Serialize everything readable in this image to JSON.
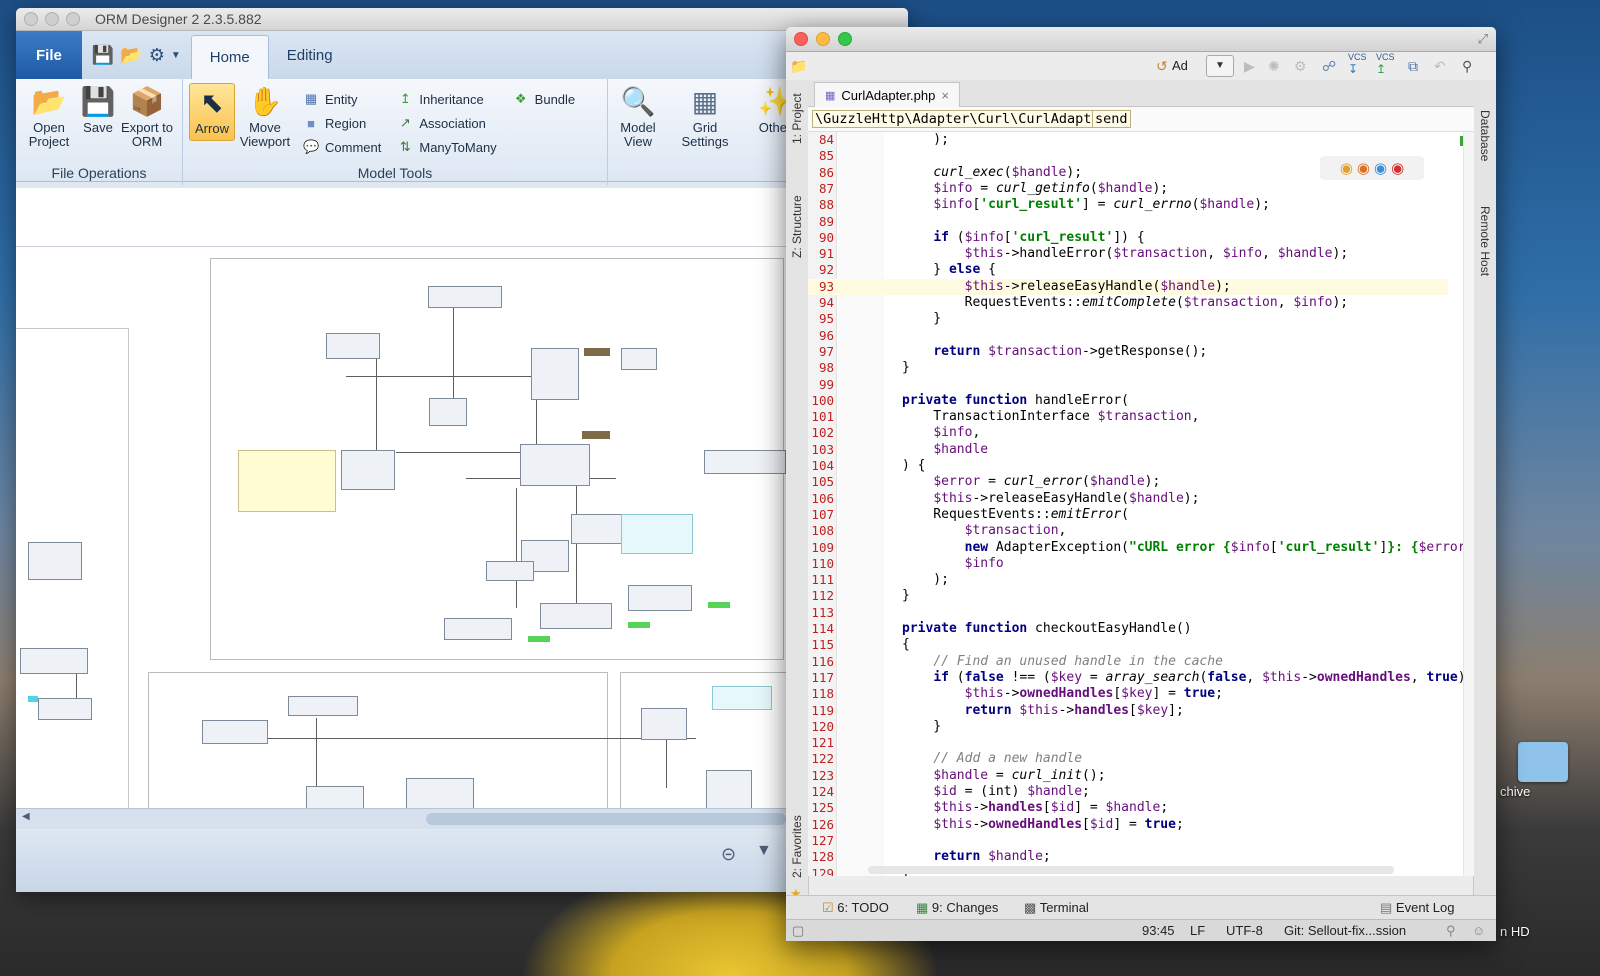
{
  "orm": {
    "title": "ORM Designer 2 2.3.5.882",
    "tabs": {
      "file": "File",
      "home": "Home",
      "editing": "Editing"
    },
    "groups": {
      "file_ops": "File Operations",
      "model_tools": "Model Tools"
    },
    "buttons": {
      "open_project": "Open Project",
      "save": "Save",
      "export_orm": "Export to ORM",
      "arrow": "Arrow",
      "move_viewport": "Move Viewport",
      "entity": "Entity",
      "region": "Region",
      "comment": "Comment",
      "inheritance": "Inheritance",
      "association": "Association",
      "many_to_many": "ManyToMany",
      "bundle": "Bundle",
      "model_view": "Model View",
      "grid_settings": "Grid Settings",
      "other": "Other"
    }
  },
  "ide": {
    "file_tab": "CurlAdapter.php",
    "toolbar_run_config": "Ad",
    "vcs1": "VCS",
    "vcs2": "VCS",
    "breadcrumb_path": "\\GuzzleHttp\\Adapter\\Curl\\CurlAdapter",
    "breadcrumb_method": "send",
    "left_tabs": {
      "project": "1: Project",
      "structure": "Z: Structure",
      "favorites": "2: Favorites"
    },
    "right_tabs": {
      "database": "Database",
      "remote_host": "Remote Host"
    },
    "bottom_tabs": {
      "todo": "6: TODO",
      "changes": "9: Changes",
      "terminal": "Terminal",
      "event_log": "Event Log"
    },
    "status": {
      "position": "93:45",
      "line_sep": "LF",
      "encoding": "UTF-8",
      "git": "Git: Sellout-fix...ssion"
    },
    "code_lines": [
      {
        "n": "84",
        "html": "    );"
      },
      {
        "n": "85",
        "html": ""
      },
      {
        "n": "86",
        "html": "    <span class='fn'>curl_exec</span>(<span class='var'>$handle</span>);"
      },
      {
        "n": "87",
        "html": "    <span class='var'>$info</span> = <span class='fn'>curl_getinfo</span>(<span class='var'>$handle</span>);"
      },
      {
        "n": "88",
        "html": "    <span class='var'>$info</span>[<span class='str'>'curl_result'</span>] = <span class='fn'>curl_errno</span>(<span class='var'>$handle</span>);"
      },
      {
        "n": "89",
        "html": ""
      },
      {
        "n": "90",
        "html": "    <span class='kw'>if</span> (<span class='var'>$info</span>[<span class='str'>'curl_result'</span>]) {"
      },
      {
        "n": "91",
        "html": "        <span class='var'>$this</span>->handleError(<span class='var'>$transaction</span>, <span class='var'>$info</span>, <span class='var'>$handle</span>);"
      },
      {
        "n": "92",
        "html": "    } <span class='kw'>else</span> {"
      },
      {
        "n": "93",
        "html": "        <span class='var'>$this</span>->releaseEasyHandle(<span class='var'>$handle</span>);",
        "cur": true
      },
      {
        "n": "94",
        "html": "        RequestEvents::<span class='fn'>emitComplete</span>(<span class='var'>$transaction</span>, <span class='var'>$info</span>);"
      },
      {
        "n": "95",
        "html": "    }"
      },
      {
        "n": "96",
        "html": ""
      },
      {
        "n": "97",
        "html": "    <span class='kw'>return</span> <span class='var'>$transaction</span>->getResponse();"
      },
      {
        "n": "98",
        "html": "}"
      },
      {
        "n": "99",
        "html": ""
      },
      {
        "n": "100",
        "html": "<span class='kw'>private function</span> handleError("
      },
      {
        "n": "101",
        "html": "    TransactionInterface <span class='var'>$transaction</span>,"
      },
      {
        "n": "102",
        "html": "    <span class='var'>$info</span>,"
      },
      {
        "n": "103",
        "html": "    <span class='var'>$handle</span>"
      },
      {
        "n": "104",
        "html": ") {"
      },
      {
        "n": "105",
        "html": "    <span class='var'>$error</span> = <span class='fn'>curl_error</span>(<span class='var'>$handle</span>);"
      },
      {
        "n": "106",
        "html": "    <span class='var'>$this</span>->releaseEasyHandle(<span class='var'>$handle</span>);"
      },
      {
        "n": "107",
        "html": "    RequestEvents::<span class='fn'>emitError</span>("
      },
      {
        "n": "108",
        "html": "        <span class='var'>$transaction</span>,"
      },
      {
        "n": "109",
        "html": "        <span class='kw'>new</span> AdapterException(<span class='str'>\"cURL error {</span><span class='var'>$info</span>[<span class='str'>'curl_result'</span>]<span class='str'>}: {</span><span class='var'>$error</span>"
      },
      {
        "n": "110",
        "html": "        <span class='var'>$info</span>"
      },
      {
        "n": "111",
        "html": "    );"
      },
      {
        "n": "112",
        "html": "}"
      },
      {
        "n": "113",
        "html": ""
      },
      {
        "n": "114",
        "html": "<span class='kw'>private function</span> checkoutEasyHandle()"
      },
      {
        "n": "115",
        "html": "{"
      },
      {
        "n": "116",
        "html": "    <span class='cmt'>// Find an unused handle in the cache</span>"
      },
      {
        "n": "117",
        "html": "    <span class='kw'>if</span> (<span class='kw'>false</span> !== (<span class='var'>$key</span> = <span class='fn'>array_search</span>(<span class='kw'>false</span>, <span class='var'>$this</span>-><span class='var'><b>ownedHandles</b></span>, <span class='kw'>true</span>)"
      },
      {
        "n": "118",
        "html": "        <span class='var'>$this</span>-><span class='var'><b>ownedHandles</b></span>[<span class='var'>$key</span>] = <span class='kw'>true</span>;"
      },
      {
        "n": "119",
        "html": "        <span class='kw'>return</span> <span class='var'>$this</span>-><span class='var'><b>handles</b></span>[<span class='var'>$key</span>];"
      },
      {
        "n": "120",
        "html": "    }"
      },
      {
        "n": "121",
        "html": ""
      },
      {
        "n": "122",
        "html": "    <span class='cmt'>// Add a new handle</span>"
      },
      {
        "n": "123",
        "html": "    <span class='var'>$handle</span> = <span class='fn'>curl_init</span>();"
      },
      {
        "n": "124",
        "html": "    <span class='var'>$id</span> = (int) <span class='var'>$handle</span>;"
      },
      {
        "n": "125",
        "html": "    <span class='var'>$this</span>-><span class='var'><b>handles</b></span>[<span class='var'>$id</span>] = <span class='var'>$handle</span>;"
      },
      {
        "n": "126",
        "html": "    <span class='var'>$this</span>-><span class='var'><b>ownedHandles</b></span>[<span class='var'>$id</span>] = <span class='kw'>true</span>;"
      },
      {
        "n": "127",
        "html": ""
      },
      {
        "n": "128",
        "html": "    <span class='kw'>return</span> <span class='var'>$handle</span>;"
      },
      {
        "n": "129",
        "html": "}"
      }
    ]
  },
  "desktop": {
    "label1": "chive",
    "label2": "n HD"
  }
}
